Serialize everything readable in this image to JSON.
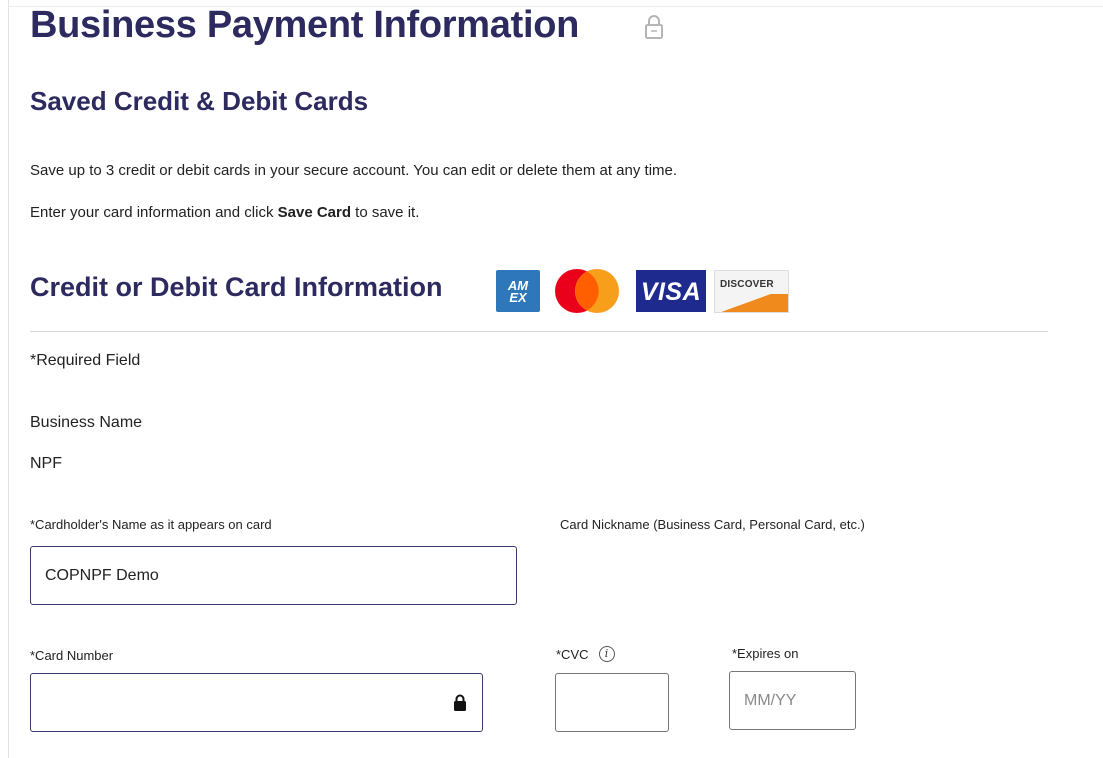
{
  "header": {
    "title": "Business Payment Information"
  },
  "section": {
    "title": "Saved Credit & Debit Cards",
    "intro_line1": "Save up to 3 credit or debit cards in your secure account. You can edit or delete them at any time.",
    "intro_line2_prefix": "Enter your card information and click ",
    "intro_line2_bold": "Save Card",
    "intro_line2_suffix": " to save it."
  },
  "card_info": {
    "title": "Credit or Debit Card Information",
    "logos": [
      {
        "name": "amex",
        "text": "AM EX",
        "color": "#2e77bb"
      },
      {
        "name": "mastercard",
        "colors": [
          "#eb001b",
          "#f79e1b",
          "#ff5f00"
        ]
      },
      {
        "name": "visa",
        "text": "VISA",
        "color": "#1f2a8f"
      },
      {
        "name": "discover",
        "text": "DISCOVER",
        "color": "#f08a1c"
      }
    ]
  },
  "form": {
    "required_note": "*Required Field",
    "business_name_label": "Business Name",
    "business_name_value": "NPF",
    "cardholder_label": "*Cardholder's Name as it appears on card",
    "cardholder_value": "COPNPF Demo",
    "nickname_label": "Card Nickname (Business Card, Personal Card, etc.)",
    "card_number_label": "*Card Number",
    "card_number_value": "",
    "cvc_label": "*CVC",
    "cvc_value": "",
    "expires_label": "*Expires on",
    "expires_placeholder": "MM/YY"
  },
  "icons": {
    "title_lock": "lock-outline-icon",
    "field_lock": "lock-filled-icon",
    "cvc_info": "info-icon"
  },
  "colors": {
    "heading": "#2c2a5e",
    "field_border": "#3a3a6a"
  }
}
